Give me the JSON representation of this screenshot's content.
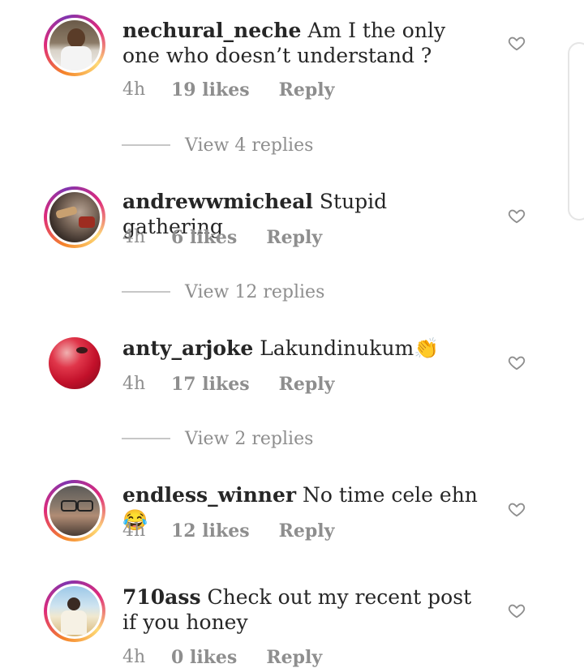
{
  "comments": [
    {
      "username": "nechural_neche",
      "text": "Am I the only one who doesn’t understand ?",
      "time": "4h",
      "likes": "19 likes",
      "reply": "Reply",
      "replies": "View 4 replies",
      "avatar": "avatar-person-white-top",
      "story": true
    },
    {
      "username": "andrewwmicheal",
      "text": "Stupid gathering",
      "time": "4h",
      "likes": "6 likes",
      "reply": "Reply",
      "replies": "View 12 replies",
      "avatar": "avatar-car-interior",
      "story": true
    },
    {
      "username": "anty_arjoke",
      "text": "Lakundinukum👏",
      "time": "4h",
      "likes": "17 likes",
      "reply": "Reply",
      "replies": "View 2 replies",
      "avatar": "avatar-red-veil",
      "story": false
    },
    {
      "username": "endless_winner",
      "text": "No time cele ehn 😂",
      "time": "4h",
      "likes": "12 likes",
      "reply": "Reply",
      "avatar": "avatar-man-glasses",
      "story": true
    },
    {
      "username": "710ass",
      "text": "Check out my recent post if you honey",
      "time": "4h",
      "likes": "0 likes",
      "reply": "Reply",
      "avatar": "avatar-person-outdoor",
      "story": true
    }
  ],
  "colors": {
    "text": "#262626",
    "meta": "#8e8e8e",
    "line": "#c7c7c7"
  }
}
